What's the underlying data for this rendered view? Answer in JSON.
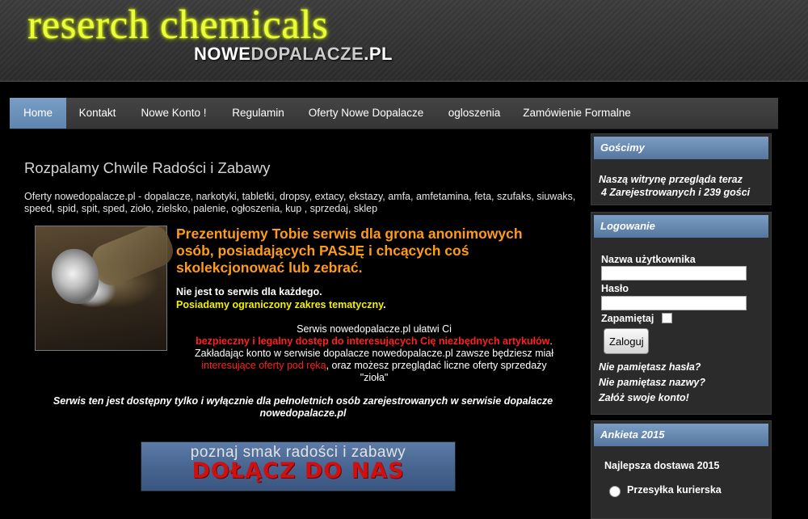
{
  "header": {
    "logo_main": "reserch chemicals",
    "logo_sub_a": "NOWE",
    "logo_sub_b": "DOPALACZE",
    "logo_sub_c": ".PL"
  },
  "nav": {
    "items": [
      "Home",
      "Kontakt",
      "Nowe Konto !",
      "Regulamin",
      "Oferty Nowe Dopalacze",
      "ogloszenia",
      "Zamówienie Formalne"
    ],
    "active": "Home"
  },
  "main": {
    "heading": "Rozpalamy Chwile Radości i Zabawy",
    "keywords": "Oferty nowedopalacze.pl - dopalacze, narkotyki, tabletki, dropsy, extacy, ekstazy, amfa, amfetamina, feta, szufaks, siuwaks, speed, spid, spit, sped, zioło, zielsko, palenie, ogłoszenia, kup , sprzedaj, sklep",
    "intro": "Prezentujemy Tobie serwis dla grona anonimowych osób, posiadających PASJĘ i chcących coś skolekcjonować lub zebrać.",
    "note_white": "Nie jest to serwis dla każdego.",
    "note_yellow": "Posiadamy ograniczony zakres tematyczny",
    "note_yellow_dot": ".",
    "service_line1": "Serwis nowedopalacze.pl ułatwi Ci",
    "service_red1": "bezpieczny i legalny dostęp do interesujących Cię niezbędnych artykułów",
    "service_dot": ".",
    "service_line3": "Zakładając konto w serwisie dopalacze nowedopalacze.pl zawsze będziesz miał",
    "service_red2": "interesujące oferty pod ręką",
    "service_line4": ", oraz możesz przeglądać liczne oferty sprzedaży",
    "service_line5": "\"zioła\"",
    "adult": "Serwis ten jest dostępny tylko i wyłącznie dla pełnoletnich osób zarejestrowanych w serwisie dopalacze nowedopalacze.pl",
    "banner_top": "poznaj smak radości i zabawy",
    "banner_main": "DOŁĄCZ DO NAS"
  },
  "sidebar": {
    "guests": {
      "title": "Gościmy",
      "line1": "Naszą witrynę przegląda teraz",
      "line2": "4 Zarejestrowanych i 239 gości"
    },
    "login": {
      "title": "Logowanie",
      "username_label": "Nazwa użytkownika",
      "username_value": "",
      "password_label": "Hasło",
      "password_value": "",
      "remember_label": "Zapamiętaj",
      "button": "Zaloguj",
      "forgot_password": "Nie pamiętasz hasła?",
      "forgot_username": "Nie pamiętasz nazwy?",
      "create_account": "Załóż swoje konto!"
    },
    "poll": {
      "title": "Ankieta 2015",
      "question": "Najlepsza dostawa 2015",
      "options": [
        "Przesyłka kurierska"
      ]
    }
  },
  "colors": {
    "accent_blue": "#6e92bd",
    "logo_yellow": "#eaff3a",
    "intro_orange": "#ff9c17",
    "highlight_red": "#ff2020",
    "highlight_yellow": "#f2f200"
  }
}
